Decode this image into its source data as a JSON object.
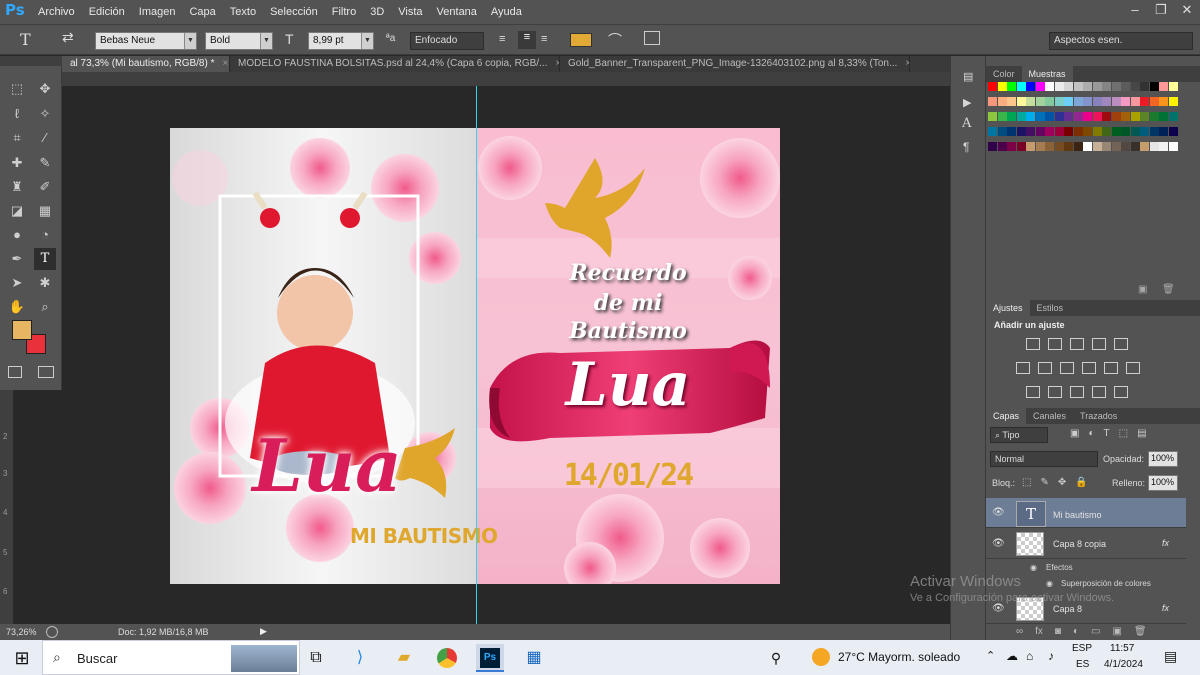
{
  "app": {
    "logo": "Ps"
  },
  "menu": [
    "Archivo",
    "Edición",
    "Imagen",
    "Capa",
    "Texto",
    "Selección",
    "Filtro",
    "3D",
    "Vista",
    "Ventana",
    "Ayuda"
  ],
  "window_controls": {
    "minimize": "–",
    "restore": "❐",
    "close": "✕"
  },
  "options": {
    "tool_glyph": "T",
    "font_family": "Bebas Neue",
    "font_style": "Bold",
    "font_size": "8,99 pt",
    "aa_label": "ªa",
    "antialias": "Enfocado",
    "text_color": "#e3a936",
    "workspace": "Aspectos esen."
  },
  "tabs": [
    {
      "label": "al 73,3% (Mi bautismo, RGB/8) *",
      "active": true
    },
    {
      "label": "MODELO FAUSTINA BOLSITAS.psd al 24,4% (Capa 6 copia, RGB/...",
      "active": false
    },
    {
      "label": "Gold_Banner_Transparent_PNG_Image-1326403102.png al 8,33% (Ton...",
      "active": false
    }
  ],
  "tools": {
    "foreground": "#e6b663",
    "background": "#e8313a",
    "icons": [
      "marquee-icon",
      "move-icon",
      "lasso-icon",
      "magic-wand-icon",
      "crop-icon",
      "eyedropper-icon",
      "healing-icon",
      "brush-icon",
      "stamp-icon",
      "history-brush-icon",
      "eraser-icon",
      "gradient-icon",
      "blur-icon",
      "dodge-icon",
      "pen-icon",
      "type-icon",
      "path-select-icon",
      "shape-icon",
      "hand-icon",
      "zoom-icon"
    ]
  },
  "ruler_left": [
    "2",
    "3",
    "4",
    "5",
    "6"
  ],
  "canvas": {
    "left_page": {
      "big_title": "Lua",
      "subtitle": "MI BAUTISMO"
    },
    "right_page": {
      "line1": "Recuerdo",
      "line2": "de mi",
      "line3": "Bautismo",
      "ribbon_name": "Lua",
      "date": "14/01/24"
    }
  },
  "statusbar": {
    "zoom": "73,26%",
    "doc": "Doc: 1,92 MB/16,8 MB"
  },
  "swatches_panel": {
    "tabs": [
      "Color",
      "Muestras"
    ],
    "active": "Muestras"
  },
  "adjustments_panel": {
    "tabs": [
      "Ajustes",
      "Estilos"
    ],
    "title": "Añadir un ajuste"
  },
  "layers_panel": {
    "tabs": [
      "Capas",
      "Canales",
      "Trazados"
    ],
    "filter_kind": "Tipo",
    "blend_mode": "Normal",
    "opacity_label": "Opacidad:",
    "opacity_value": "100%",
    "lock_label": "Bloq.:",
    "fill_label": "Relleno:",
    "fill_value": "100%",
    "layers": [
      {
        "name": "Mi bautismo",
        "type": "text",
        "selected": true
      },
      {
        "name": "Capa 8 copia",
        "type": "raster",
        "fx": "fx"
      },
      {
        "name": "Efectos",
        "type": "effects"
      },
      {
        "name": "Superposición de colores",
        "type": "effect"
      },
      {
        "name": "Capa 8",
        "type": "raster",
        "fx": "fx"
      }
    ]
  },
  "watermark": {
    "line1": "Activar Windows",
    "line2": "Ve a Configuración para activar Windows."
  },
  "taskbar": {
    "search_placeholder": "Buscar",
    "weather": "27°C  Mayorm. soleado",
    "lang1": "ESP",
    "lang2": "ES",
    "time": "11:57",
    "date": "4/1/2024"
  }
}
